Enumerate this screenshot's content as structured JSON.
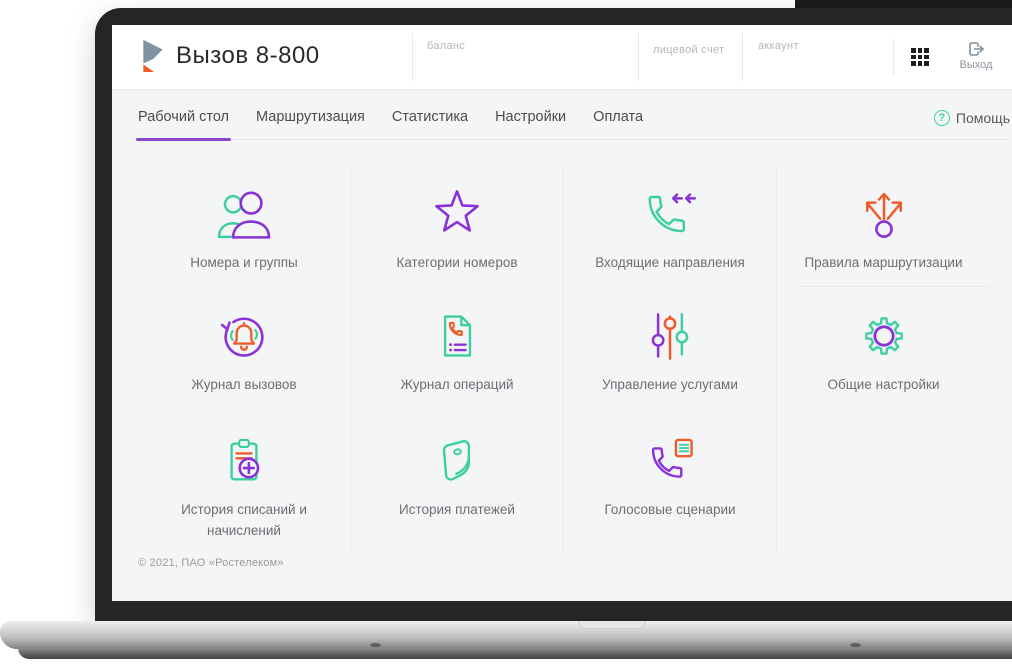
{
  "header": {
    "app_title": "Вызов 8-800",
    "balance_label": "баланс",
    "personal_account_label": "лицевой счет",
    "account_label": "аккаунт",
    "logout_label": "Выход"
  },
  "nav": {
    "tabs": [
      {
        "label": "Рабочий стол",
        "active": true
      },
      {
        "label": "Маршрутизация",
        "active": false
      },
      {
        "label": "Статистика",
        "active": false
      },
      {
        "label": "Настройки",
        "active": false
      },
      {
        "label": "Оплата",
        "active": false
      }
    ],
    "help_label": "Помощь"
  },
  "grid": {
    "items": [
      {
        "label": "Номера и группы",
        "icon": "users-icon"
      },
      {
        "label": "Категории номеров",
        "icon": "star-icon"
      },
      {
        "label": "Входящие направления",
        "icon": "incoming-call-icon"
      },
      {
        "label": "Правила маршрутизации",
        "icon": "routing-arrows-icon"
      },
      {
        "label": "Журнал вызовов",
        "icon": "call-log-bell-icon"
      },
      {
        "label": "Журнал операций",
        "icon": "operations-doc-icon"
      },
      {
        "label": "Управление услугами",
        "icon": "sliders-icon"
      },
      {
        "label": "Общие настройки",
        "icon": "gear-icon"
      },
      {
        "label": "История списаний и начислений",
        "icon": "clipboard-plus-icon"
      },
      {
        "label": "История платежей",
        "icon": "wallet-icon"
      },
      {
        "label": "Голосовые сценарии",
        "icon": "voice-script-icon"
      }
    ]
  },
  "footer": {
    "copyright": "© 2021, ПАО «Ростелеком»"
  },
  "colors": {
    "purple": "#8a32d7",
    "green": "#3ecfa0",
    "orange": "#f05b2c",
    "tab_underline": "#8a46cc",
    "logo_slate": "#7e94a3",
    "logo_orange": "#f05a28"
  }
}
